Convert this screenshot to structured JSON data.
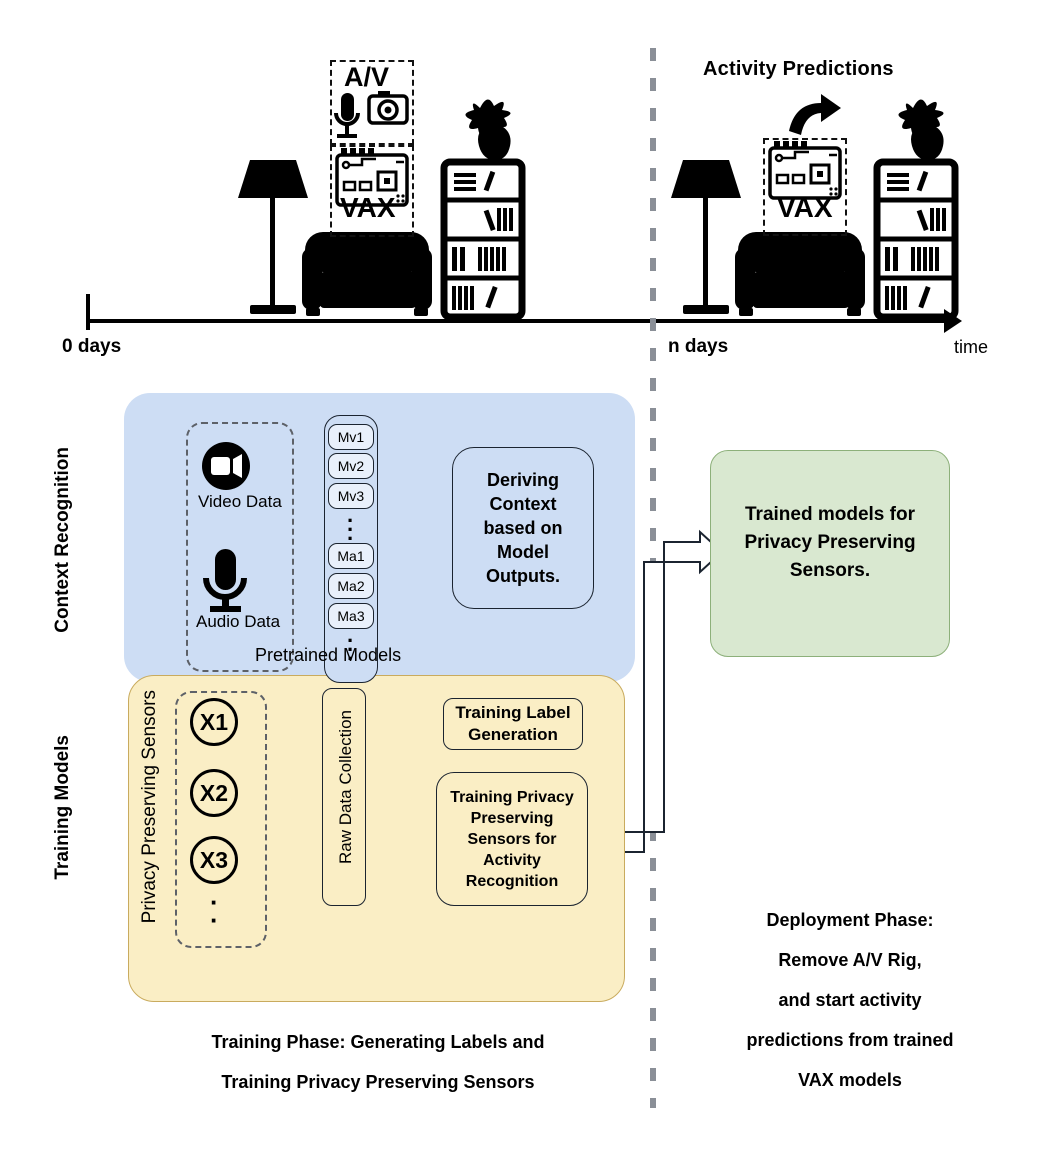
{
  "timeline": {
    "start_label": "0 days",
    "mid_label": "n days",
    "axis_label": "time",
    "prediction_label": "Activity Predictions",
    "left_scene": {
      "av_label": "A/V",
      "vax_label": "VAX",
      "icons": [
        "microphone-icon",
        "camera-icon",
        "circuit-board-icon",
        "floor-lamp-icon",
        "sofa-icon",
        "bookshelf-icon",
        "potted-plant-icon"
      ]
    },
    "right_scene": {
      "vax_label": "VAX",
      "icons": [
        "circuit-board-icon",
        "curved-arrow-icon",
        "floor-lamp-icon",
        "sofa-icon",
        "bookshelf-icon",
        "potted-plant-icon"
      ]
    }
  },
  "context_recognition": {
    "section_label": "Context Recognition",
    "sources": [
      {
        "label": "Video Data",
        "icon": "video-camera-icon"
      },
      {
        "label": "Audio Data",
        "icon": "microphone-icon"
      }
    ],
    "models_group_label": "Pretrained Models",
    "video_models": [
      "Mv1",
      "Mv2",
      "Mv3"
    ],
    "audio_models": [
      "Ma1",
      "Ma2",
      "Ma3"
    ],
    "deriving_box": "Deriving Context based on Model Outputs."
  },
  "training_models": {
    "section_label": "Training Models",
    "sensors_group_label": "Privacy Preserving Sensors",
    "sensors": [
      "X1",
      "X2",
      "X3"
    ],
    "raw_data_label": "Raw Data Collection",
    "label_gen_box": "Training Label Generation",
    "training_box": "Training Privacy Preserving Sensors for Activity Recognition"
  },
  "output": {
    "trained_models_box": "Trained models for Privacy Preserving Sensors."
  },
  "captions": {
    "training_phase": "Training Phase: Generating Labels and\nTraining Privacy Preserving Sensors",
    "deployment_phase": "Deployment Phase:\nRemove A/V Rig,\nand start activity\npredictions from trained\nVAX models"
  },
  "colors": {
    "context_panel": "#cdddf4",
    "training_panel": "#faeec5",
    "output_box": "#d9e8d0",
    "divider": "#8a8f97",
    "stroke": "#1b2430"
  }
}
